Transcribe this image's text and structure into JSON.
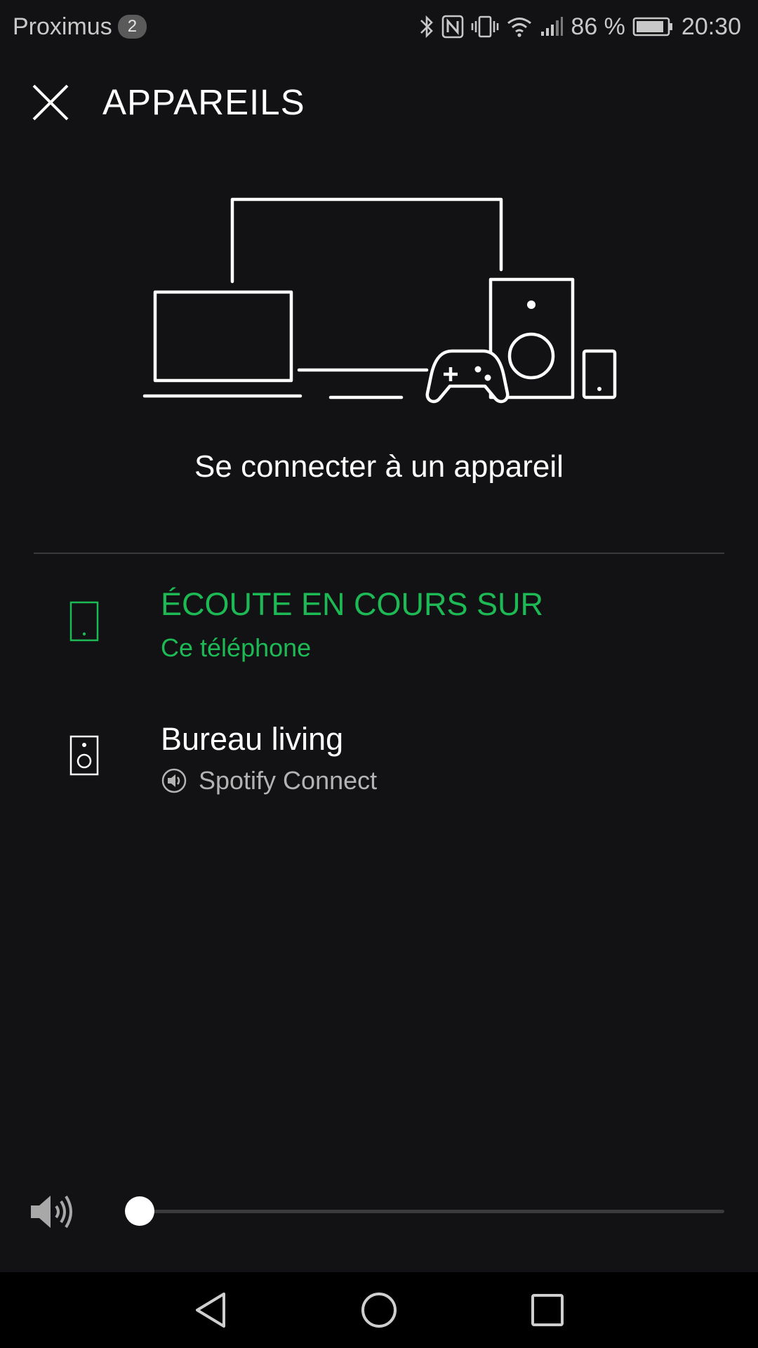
{
  "status_bar": {
    "carrier": "Proximus",
    "carrier_badge": "2",
    "battery_text": "86 %",
    "time": "20:30",
    "icons": [
      "bluetooth-icon",
      "nfc-icon",
      "vibrate-icon",
      "wifi-icon",
      "signal-icon",
      "battery-icon"
    ]
  },
  "header": {
    "title": "APPAREILS",
    "close_icon": "close-icon"
  },
  "hero": {
    "illustration": "devices-illustration",
    "heading": "Se connecter à un appareil"
  },
  "devices": {
    "current": {
      "title": "ÉCOUTE EN COURS SUR",
      "subtitle": "Ce téléphone",
      "icon": "phone-icon"
    },
    "other": [
      {
        "title": "Bureau living",
        "subtitle": "Spotify Connect",
        "icon": "speaker-icon",
        "subtitle_icon": "spotify-connect-icon"
      }
    ]
  },
  "volume": {
    "icon": "volume-icon",
    "level": 0.02
  },
  "nav_bar": {
    "buttons": [
      "back-icon",
      "home-icon",
      "recents-icon"
    ]
  },
  "colors": {
    "background": "#121214",
    "accent": "#1db954",
    "secondary_text": "#b3b3b3"
  }
}
